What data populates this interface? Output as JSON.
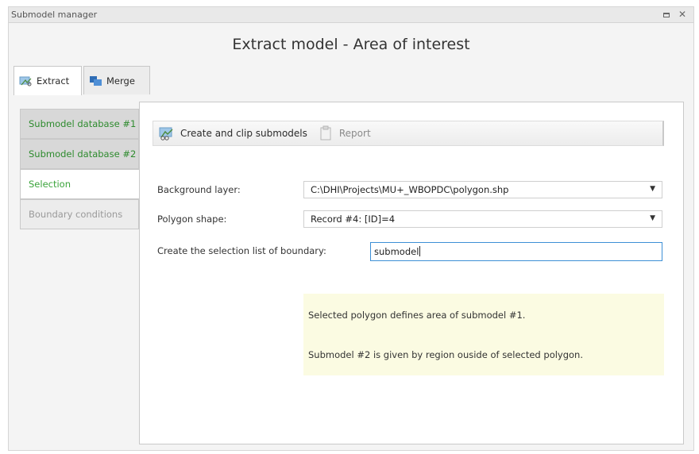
{
  "window": {
    "title": "Submodel manager",
    "maximize_label": "□",
    "close_label": "✕"
  },
  "header": {
    "title": "Extract model - Area of interest"
  },
  "tabs": [
    {
      "label": "Extract",
      "icon": "extract-icon",
      "active": true
    },
    {
      "label": "Merge",
      "icon": "merge-icon",
      "active": false
    }
  ],
  "sidebar": {
    "items": [
      {
        "label": "Submodel database #1",
        "state": "done"
      },
      {
        "label": "Submodel database #2",
        "state": "done"
      },
      {
        "label": "Selection",
        "state": "active"
      },
      {
        "label": "Boundary conditions",
        "state": "disabled"
      }
    ]
  },
  "toolbar": {
    "create_label": "Create and clip submodels",
    "report_label": "Report"
  },
  "form": {
    "background_layer_label": "Background layer:",
    "background_layer_value": "C:\\DHI\\Projects\\MU+_WBOPDC\\polygon.shp",
    "polygon_shape_label": "Polygon shape:",
    "polygon_shape_value": "Record #4: [ID]=4",
    "selection_list_label": "Create the selection list of boundary:",
    "selection_list_value": "submodel"
  },
  "info": {
    "line1": "Selected polygon defines area of submodel #1.",
    "line2": "Submodel #2 is given by region ouside of selected polygon."
  },
  "colors": {
    "accent_green": "#3aa33a",
    "input_focus": "#3d8fd6",
    "info_background": "#fbfbe2"
  }
}
